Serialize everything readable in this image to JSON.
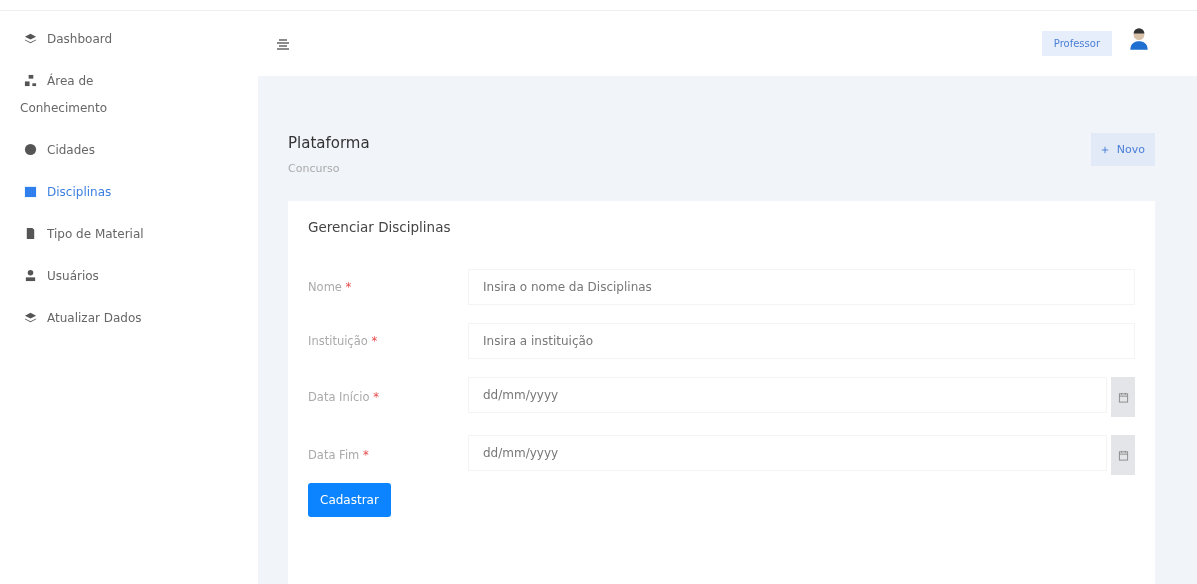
{
  "sidebar": {
    "items": [
      {
        "label": "Dashboard",
        "selected": false
      },
      {
        "label": "Área de Conhecimento",
        "selected": false
      },
      {
        "label": "Cidades",
        "selected": false
      },
      {
        "label": "Disciplinas",
        "selected": true
      },
      {
        "label": "Tipo de Material",
        "selected": false
      },
      {
        "label": "Usuários",
        "selected": false
      },
      {
        "label": "Atualizar Dados",
        "selected": false
      }
    ]
  },
  "topbar": {
    "role": "Professor"
  },
  "header": {
    "title": "Plataforma",
    "subtitle": "Concurso",
    "new_button": "Novo"
  },
  "form": {
    "title": "Gerenciar Disciplinas",
    "fields": [
      {
        "label": "Nome",
        "mark": "*",
        "kind": "text",
        "placeholder": "Insira o nome da Disciplinas"
      },
      {
        "label": "Instituição",
        "mark": "*",
        "kind": "text",
        "placeholder": "Insira a instituição"
      },
      {
        "label": "Data Início",
        "mark": "*",
        "kind": "date",
        "placeholder": "dd/mm/yyyy"
      },
      {
        "label": "Data Fim",
        "mark": "*",
        "kind": "date",
        "placeholder": "dd/mm/yyyy"
      }
    ],
    "submit": "Cadastrar"
  }
}
